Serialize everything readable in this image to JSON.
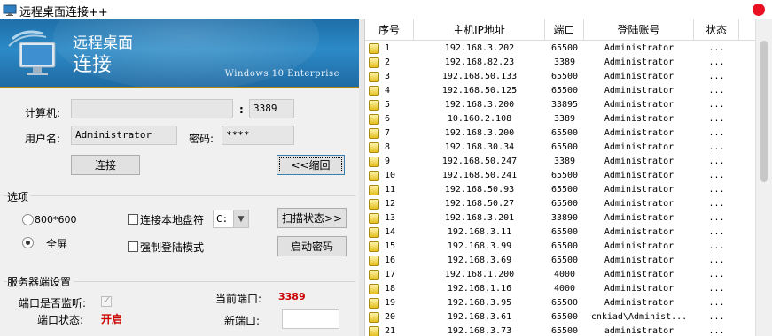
{
  "window": {
    "title": "远程桌面连接++"
  },
  "banner": {
    "title_line1": "远程桌面",
    "title_line2": "连接",
    "subtitle": "Windows 10 Enterprise"
  },
  "connect": {
    "computer_label": "计算机:",
    "computer_value": "",
    "port_sep": ":",
    "port_value": "3389",
    "username_label": "用户名:",
    "username_value": "Administrator",
    "password_label": "密码:",
    "password_value": "****",
    "connect_button": "连接",
    "collapse_button": "<<缩回"
  },
  "options": {
    "group_title": "选项",
    "res_800": "800*600",
    "res_full": "全屏",
    "map_drive_label": "连接本地盘符",
    "drive_value": "C:",
    "force_login_label": "强制登陆模式",
    "scan_button": "扫描状态>>",
    "start_pwd_button": "启动密码"
  },
  "server": {
    "group_title": "服务器端设置",
    "listening_label": "端口是否监听:",
    "current_port_label": "当前端口:",
    "current_port_value": "3389",
    "port_status_label": "端口状态:",
    "port_status_value": "开启",
    "new_port_label": "新端口:",
    "new_port_value": ""
  },
  "table": {
    "headers": [
      "序号",
      "主机IP地址",
      "端口",
      "登陆账号",
      "状态"
    ],
    "rows": [
      {
        "id": "1",
        "ip": "192.168.3.202",
        "port": "65500",
        "account": "Administrator",
        "status": "..."
      },
      {
        "id": "2",
        "ip": "192.168.82.23",
        "port": "3389",
        "account": "Administrator",
        "status": "..."
      },
      {
        "id": "3",
        "ip": "192.168.50.133",
        "port": "65500",
        "account": "Administrator",
        "status": "..."
      },
      {
        "id": "4",
        "ip": "192.168.50.125",
        "port": "65500",
        "account": "Administrator",
        "status": "..."
      },
      {
        "id": "5",
        "ip": "192.168.3.200",
        "port": "33895",
        "account": "Administrator",
        "status": "..."
      },
      {
        "id": "6",
        "ip": "10.160.2.108",
        "port": "3389",
        "account": "Administrator",
        "status": "..."
      },
      {
        "id": "7",
        "ip": "192.168.3.200",
        "port": "65500",
        "account": "Administrator",
        "status": "..."
      },
      {
        "id": "8",
        "ip": "192.168.30.34",
        "port": "65500",
        "account": "Administrator",
        "status": "..."
      },
      {
        "id": "9",
        "ip": "192.168.50.247",
        "port": "3389",
        "account": "Administrator",
        "status": "..."
      },
      {
        "id": "10",
        "ip": "192.168.50.241",
        "port": "65500",
        "account": "Administrator",
        "status": "..."
      },
      {
        "id": "11",
        "ip": "192.168.50.93",
        "port": "65500",
        "account": "Administrator",
        "status": "..."
      },
      {
        "id": "12",
        "ip": "192.168.50.27",
        "port": "65500",
        "account": "Administrator",
        "status": "..."
      },
      {
        "id": "13",
        "ip": "192.168.3.201",
        "port": "33890",
        "account": "Administrator",
        "status": "..."
      },
      {
        "id": "14",
        "ip": "192.168.3.11",
        "port": "65500",
        "account": "Administrator",
        "status": "..."
      },
      {
        "id": "15",
        "ip": "192.168.3.99",
        "port": "65500",
        "account": "Administrator",
        "status": "..."
      },
      {
        "id": "16",
        "ip": "192.168.3.69",
        "port": "65500",
        "account": "Administrator",
        "status": "..."
      },
      {
        "id": "17",
        "ip": "192.168.1.200",
        "port": "4000",
        "account": "Administrator",
        "status": "..."
      },
      {
        "id": "18",
        "ip": "192.168.1.16",
        "port": "4000",
        "account": "Administrator",
        "status": "..."
      },
      {
        "id": "19",
        "ip": "192.168.3.95",
        "port": "65500",
        "account": "Administrator",
        "status": "..."
      },
      {
        "id": "20",
        "ip": "192.168.3.61",
        "port": "65500",
        "account": "cnkiad\\Administ...",
        "status": "..."
      },
      {
        "id": "21",
        "ip": "192.168.3.73",
        "port": "65500",
        "account": "administrator",
        "status": "..."
      }
    ]
  },
  "colors": {
    "banner_blue": "#1f6aa3",
    "status_red": "#cc0000",
    "row_icon_yellow": "#e3c01f"
  }
}
